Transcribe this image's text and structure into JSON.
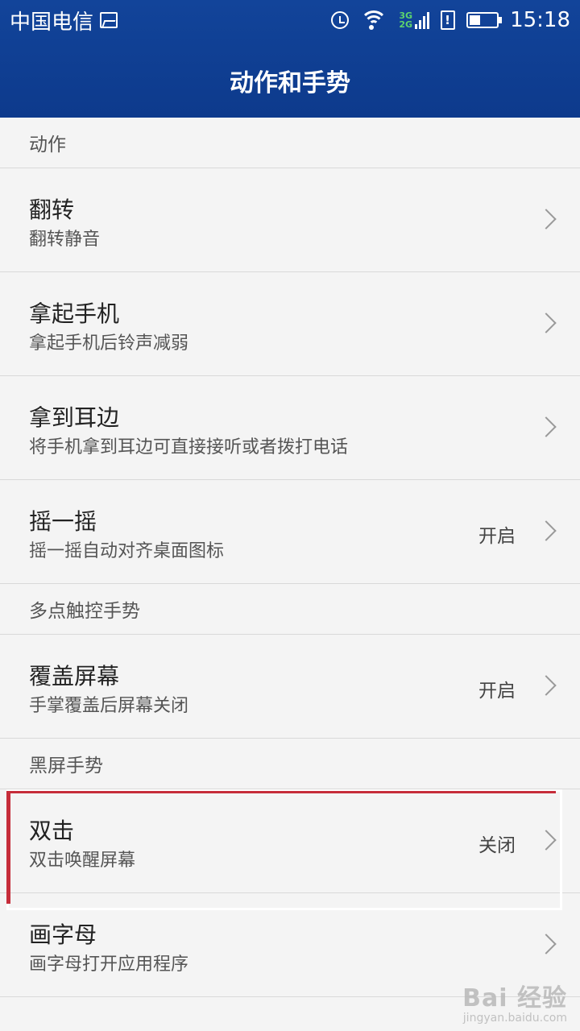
{
  "status_bar": {
    "carrier": "中国电信",
    "network_labels": [
      "3G",
      "2G"
    ],
    "time": "15:18",
    "battery_level": 0.4,
    "icons": [
      "image-icon",
      "alarm-icon",
      "wifi-icon",
      "mobile-signal-icon",
      "sim-alert-icon",
      "battery-icon"
    ]
  },
  "app_bar": {
    "title": "动作和手势"
  },
  "sections": [
    {
      "header": "动作",
      "items": [
        {
          "label": "翻转",
          "sublabel": "翻转静音",
          "value": ""
        },
        {
          "label": "拿起手机",
          "sublabel": "拿起手机后铃声减弱",
          "value": ""
        },
        {
          "label": "拿到耳边",
          "sublabel": "将手机拿到耳边可直接接听或者拨打电话",
          "value": ""
        },
        {
          "label": "摇一摇",
          "sublabel": "摇一摇自动对齐桌面图标",
          "value": "开启"
        }
      ]
    },
    {
      "header": "多点触控手势",
      "items": [
        {
          "label": "覆盖屏幕",
          "sublabel": "手掌覆盖后屏幕关闭",
          "value": "开启"
        }
      ]
    },
    {
      "header": "黑屏手势",
      "items": [
        {
          "label": "双击",
          "sublabel": "双击唤醒屏幕",
          "value": "关闭"
        },
        {
          "label": "画字母",
          "sublabel": "画字母打开应用程序",
          "value": ""
        }
      ]
    }
  ],
  "colors": {
    "header": "#0d3a8c",
    "highlight": "#c62d3a",
    "background": "#f4f4f4"
  },
  "watermark": {
    "main": "Bai 经验",
    "sub": "jingyan.baidu.com"
  }
}
